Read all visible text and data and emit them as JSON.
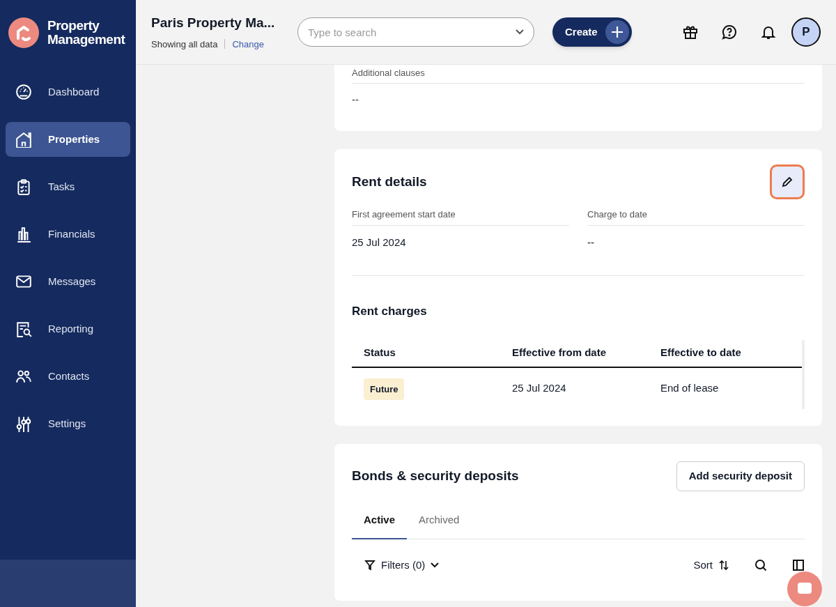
{
  "brand": {
    "line_1": "Property",
    "line_2": "Management"
  },
  "header": {
    "title": "Paris Property Ma...",
    "subtitle": "Showing all data",
    "change_link": "Change",
    "search": {
      "placeholder": "Type to search"
    },
    "create_button": "Create",
    "avatar": "P"
  },
  "sidebar": {
    "items": [
      {
        "label": "Dashboard",
        "selected": false
      },
      {
        "label": "Properties",
        "selected": true
      },
      {
        "label": "Tasks",
        "selected": false
      },
      {
        "label": "Financials",
        "selected": false
      },
      {
        "label": "Messages",
        "selected": false
      },
      {
        "label": "Reporting",
        "selected": false
      },
      {
        "label": "Contacts",
        "selected": false
      },
      {
        "label": "Settings",
        "selected": false
      }
    ]
  },
  "additional_clauses": {
    "label": "Additional clauses",
    "value": "--"
  },
  "rent_details": {
    "title": "Rent details",
    "fields": [
      {
        "label": "First agreement start date",
        "value": "25 Jul 2024"
      },
      {
        "label": "Charge to date",
        "value": "--"
      }
    ],
    "rent_charges": {
      "title": "Rent charges",
      "columns": [
        "Status",
        "Effective from date",
        "Effective to date"
      ],
      "rows": [
        {
          "status": "Future",
          "from": "25 Jul 2024",
          "to": "End of lease"
        }
      ]
    }
  },
  "bonds": {
    "title": "Bonds & security deposits",
    "add_button": "Add security deposit",
    "tabs": [
      {
        "label": "Active",
        "selected": true
      },
      {
        "label": "Archived",
        "selected": false
      }
    ],
    "filters": "Filters (0)",
    "sort": "Sort"
  }
}
